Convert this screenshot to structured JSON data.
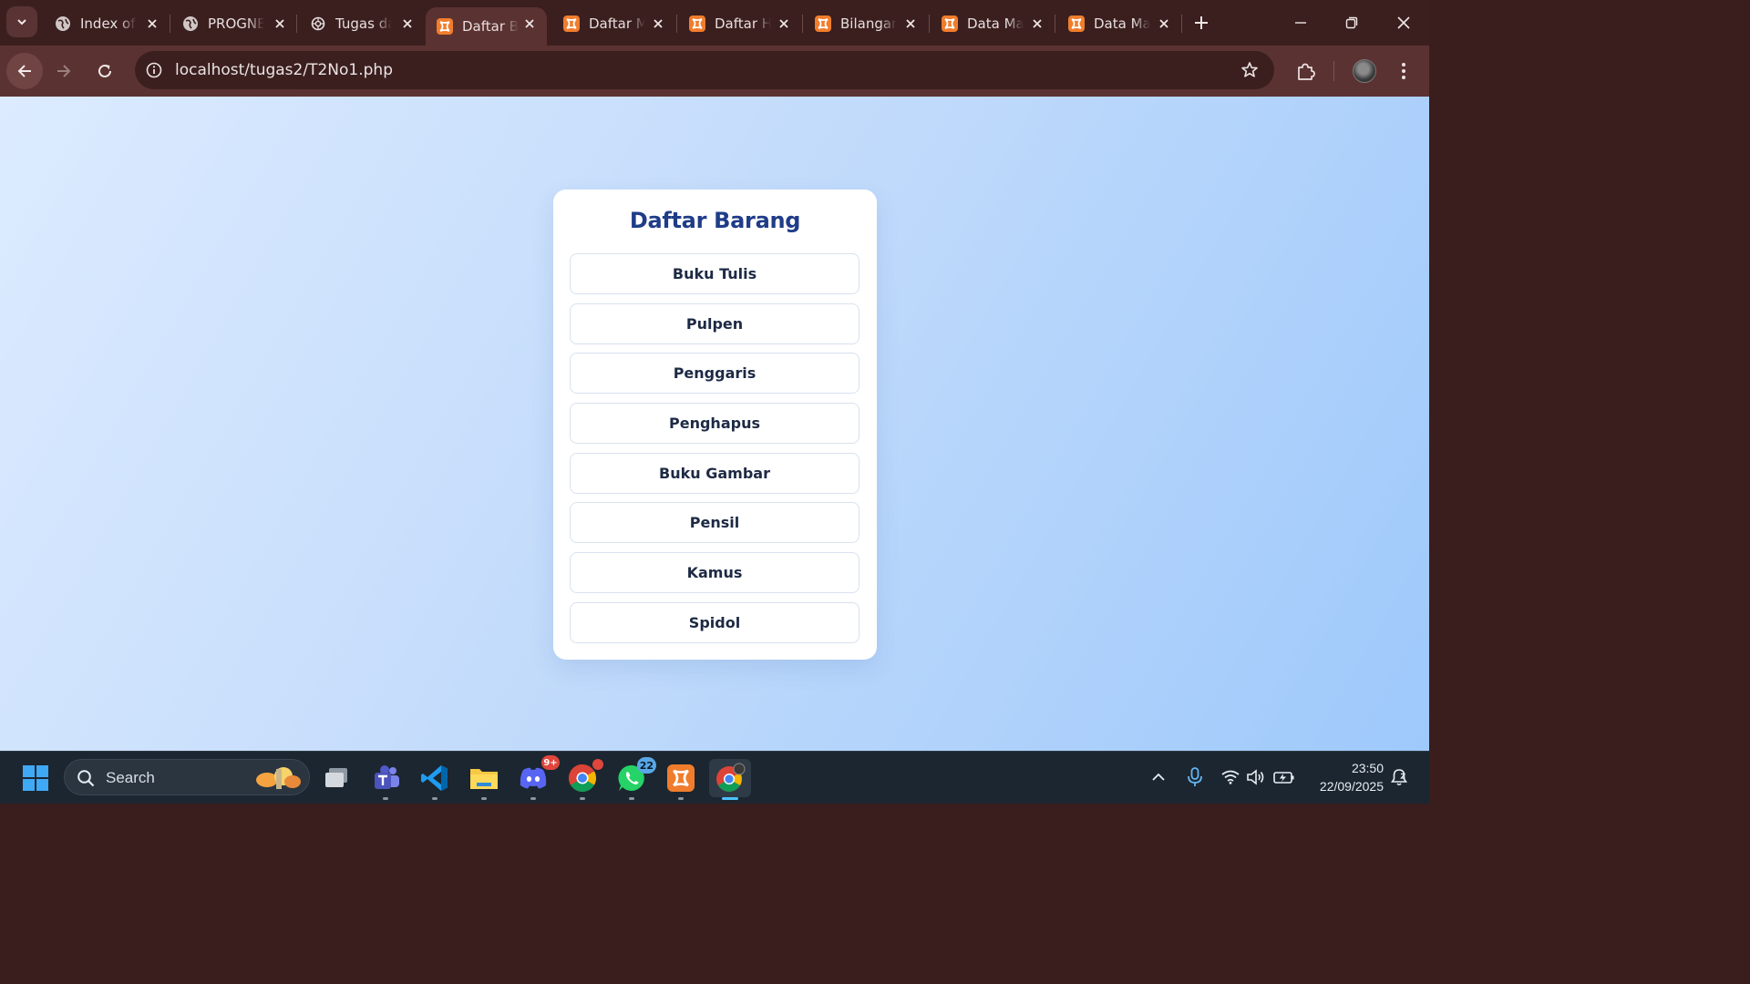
{
  "browser": {
    "tabs": [
      {
        "title": "Index of /",
        "favicon": "globe-icon",
        "active": false
      },
      {
        "title": "PROGNET",
        "favicon": "globe-icon",
        "active": false
      },
      {
        "title": "Tugas dari",
        "favicon": "openai-icon",
        "active": false
      },
      {
        "title": "Daftar Barang",
        "favicon": "xampp-icon",
        "active": true
      },
      {
        "title": "Daftar Mahasiswa",
        "favicon": "xampp-icon",
        "active": false
      },
      {
        "title": "Daftar Harga",
        "favicon": "xampp-icon",
        "active": false
      },
      {
        "title": "Bilangan",
        "favicon": "xampp-icon",
        "active": false
      },
      {
        "title": "Data Mahasiswa",
        "favicon": "xampp-icon",
        "active": false
      },
      {
        "title": "Data Mahasiswa",
        "favicon": "xampp-icon",
        "active": false
      }
    ],
    "url": "localhost/tugas2/T2No1.php"
  },
  "page": {
    "title": "Daftar Barang",
    "items": [
      "Buku Tulis",
      "Pulpen",
      "Penggaris",
      "Penghapus",
      "Buku Gambar",
      "Pensil",
      "Kamus",
      "Spidol"
    ]
  },
  "taskbar": {
    "search_label": "Search",
    "apps": [
      {
        "name": "task-view-icon"
      },
      {
        "name": "teams-icon"
      },
      {
        "name": "vscode-icon"
      },
      {
        "name": "file-explorer-icon"
      },
      {
        "name": "discord-icon",
        "badge": "9+"
      },
      {
        "name": "chrome-icon",
        "badge": ""
      },
      {
        "name": "whatsapp-icon",
        "badge": "22"
      },
      {
        "name": "xampp-icon"
      },
      {
        "name": "chrome-profile-icon"
      }
    ],
    "time": "23:50",
    "date": "22/09/2025"
  },
  "colors": {
    "tab_strip": "#3b1f1f",
    "toolbar": "#5b3232",
    "page_gradient_start": "#dcebff",
    "page_gradient_end": "#9ec9fb",
    "title_color": "#1f3c88",
    "taskbar": "#1c2630"
  }
}
